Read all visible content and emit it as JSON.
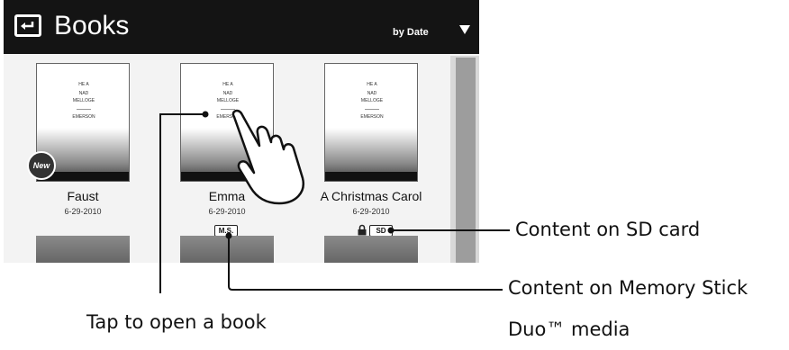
{
  "header": {
    "title": "Books",
    "sort_label": "by Date",
    "back_icon": "back-arrow-icon",
    "sort_icon": "dropdown-triangle-icon"
  },
  "books": [
    {
      "title": "Faust",
      "date": "6-29-2010",
      "new": "New",
      "cover_lines": [
        "HE A",
        "NAD",
        "MELLOGE",
        "...",
        "EMERSON"
      ]
    },
    {
      "title": "Emma",
      "date": "6-29-2010",
      "storage": "M.S.",
      "cover_lines": [
        "HE A",
        "NAD",
        "MELLOGE",
        "...",
        "EMERSON"
      ]
    },
    {
      "title": "A Christmas Carol",
      "date": "6-29-2010",
      "storage": "SD",
      "locked": true,
      "cover_lines": [
        "HE A",
        "NAD",
        "MELLOGE",
        "...",
        "EMERSON"
      ]
    }
  ],
  "callouts": {
    "sd": "Content on SD card",
    "ms_line1": "Content on Memory Stick",
    "ms_line2": "Duo™ media",
    "tap": "Tap to open a book"
  },
  "icons": {
    "hand": "tap-hand-icon",
    "lock": "lock-icon"
  }
}
